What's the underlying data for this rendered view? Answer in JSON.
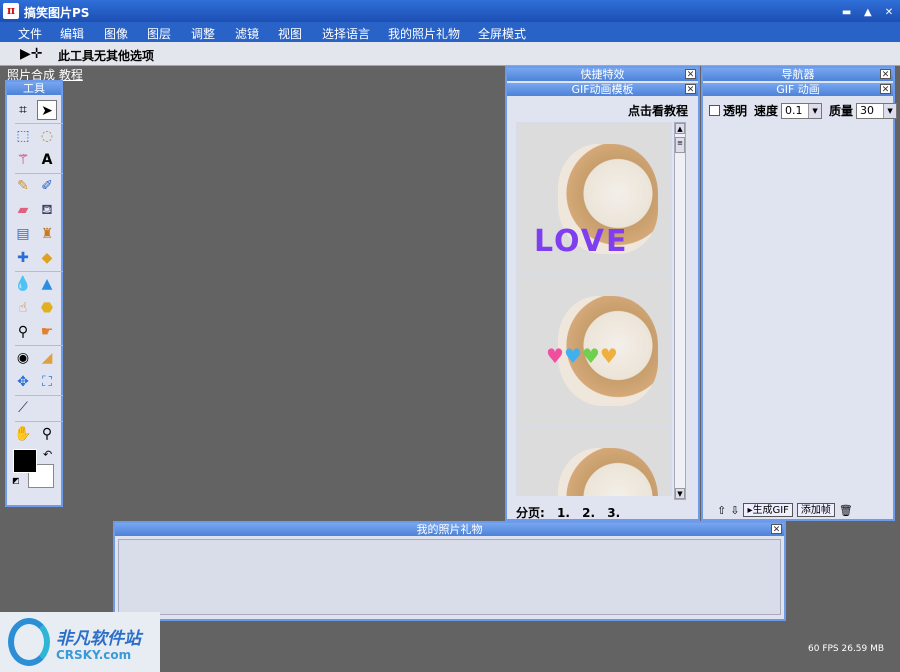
{
  "window": {
    "title": "搞笑图片PS",
    "app_icon_glyph": "π",
    "controls": [
      "minimize-icon",
      "restore-icon",
      "close-icon"
    ]
  },
  "menu": [
    "文件",
    "编辑",
    "图像",
    "图层",
    "调整",
    "滤镜",
    "视图",
    "选择语言",
    "我的照片礼物",
    "全屏模式"
  ],
  "options_bar": {
    "text": "此工具无其他选项",
    "tool_icon": "move-icon"
  },
  "tutorial_link": "照片合成 教程",
  "tools_panel": {
    "title": "工具",
    "tools": [
      "crop-icon",
      "move-icon",
      "marquee-icon",
      "lasso-icon",
      "magic-wand-icon",
      "text-icon",
      "pencil-icon",
      "brush-icon",
      "eraser-icon",
      "paint-bucket-icon",
      "gradient-icon",
      "clone-stamp-icon",
      "healing-icon",
      "shape-icon",
      "blur-icon",
      "sharpen-icon",
      "smudge-icon",
      "sponge-icon",
      "dodge-icon",
      "burn-icon",
      "red-eye-icon",
      "patch-icon",
      "transform-icon",
      "warp-icon",
      "eyedropper-icon",
      "hand-icon",
      "zoom-icon"
    ],
    "foreground_color": "#000000",
    "background_color": "#ffffff"
  },
  "effects_panel": {
    "title": "快捷特效"
  },
  "gif_templates_panel": {
    "title": "GIF动画模板",
    "tutorial_link": "点击看教程",
    "pager_label": "分页:",
    "pages": [
      "1.",
      "2.",
      "3."
    ],
    "thumb1_text": "LOVE"
  },
  "navigator_panel": {
    "title": "导航器"
  },
  "gif_anim_panel": {
    "title": "GIF 动画",
    "transparent_label": "透明",
    "speed_label": "速度",
    "speed_value": "0.1",
    "quality_label": "质量",
    "quality_value": "30",
    "generate_label": "生成GIF",
    "add_frame_label": "添加帧"
  },
  "gift_panel": {
    "title": "我的照片礼物"
  },
  "status": "60 FPS 26.59 MB",
  "watermark": {
    "cn": "非凡软件站",
    "en": "CRSKY.com"
  }
}
